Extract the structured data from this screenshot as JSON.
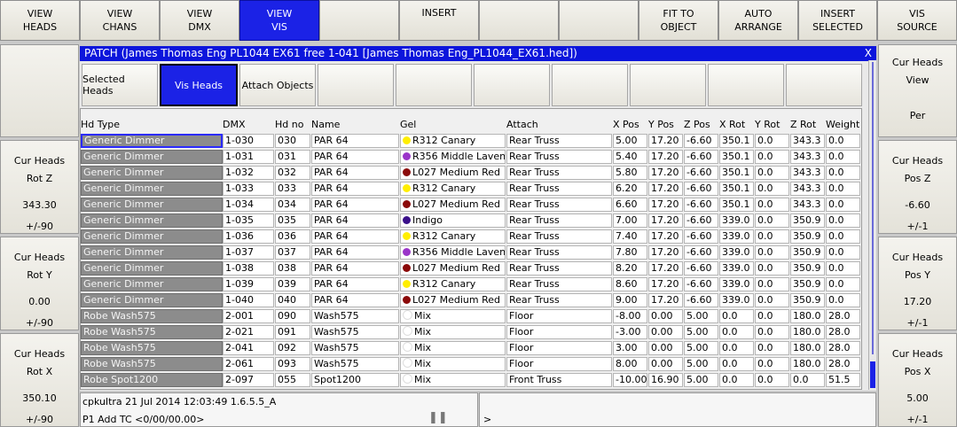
{
  "toolbar": {
    "view_heads": [
      "VIEW",
      "HEADS"
    ],
    "view_chans": [
      "VIEW",
      "CHANS"
    ],
    "view_dmx": [
      "VIEW",
      "DMX"
    ],
    "view_vis": [
      "VIEW",
      "VIS"
    ],
    "insert": "INSERT",
    "fit_to_object": [
      "FIT TO",
      "OBJECT"
    ],
    "auto_arrange": [
      "AUTO",
      "ARRANGE"
    ],
    "insert_selected": [
      "INSERT",
      "SELECTED"
    ],
    "vis_source": [
      "VIS",
      "SOURCE"
    ]
  },
  "left_panel": {
    "rot_z": {
      "title": "Cur Heads",
      "label": "Rot Z",
      "value": "343.30",
      "step": "+/-90"
    },
    "rot_y": {
      "title": "Cur Heads",
      "label": "Rot Y",
      "value": "0.00",
      "step": "+/-90"
    },
    "rot_x": {
      "title": "Cur Heads",
      "label": "Rot X",
      "value": "350.10",
      "step": "+/-90"
    }
  },
  "right_panel": {
    "view": {
      "title": "Cur Heads",
      "label": "View",
      "value": "Per"
    },
    "pos_z": {
      "title": "Cur Heads",
      "label": "Pos Z",
      "value": "-6.60",
      "step": "+/-1"
    },
    "pos_y": {
      "title": "Cur Heads",
      "label": "Pos Y",
      "value": "17.20",
      "step": "+/-1"
    },
    "pos_x": {
      "title": "Cur Heads",
      "label": "Pos X",
      "value": "5.00",
      "step": "+/-1"
    }
  },
  "window": {
    "title": "PATCH (James Thomas Eng PL1044 EX61 free 1-041 [James Thomas Eng_PL1044_EX61.hed])",
    "close": "X"
  },
  "tabs": [
    "Selected Heads",
    "Vis Heads",
    "Attach Objects"
  ],
  "columns": [
    "Hd Type",
    "DMX",
    "Hd no",
    "Name",
    "Gel",
    "Attach",
    "X Pos",
    "Y Pos",
    "Z Pos",
    "X Rot",
    "Y Rot",
    "Z Rot",
    "Weight"
  ],
  "colors": {
    "canary": "#ffee00",
    "lavender": "#9a35c9",
    "medium_red": "#8b0a0a",
    "indigo": "#3a108a",
    "mix": "#ffffff"
  },
  "rows": [
    {
      "type": "Generic Dimmer",
      "dmx": "1-030",
      "hd": "030",
      "name": "PAR 64",
      "gel": "R312 Canary",
      "gelc": "#ffee00",
      "attach": "Rear Truss",
      "x": "5.00",
      "y": "17.20",
      "z": "-6.60",
      "xr": "350.1",
      "yr": "0.0",
      "zr": "343.3",
      "w": "0.0"
    },
    {
      "type": "Generic Dimmer",
      "dmx": "1-031",
      "hd": "031",
      "name": "PAR 64",
      "gel": "R356 Middle Lavende",
      "gelc": "#9a35c9",
      "attach": "Rear Truss",
      "x": "5.40",
      "y": "17.20",
      "z": "-6.60",
      "xr": "350.1",
      "yr": "0.0",
      "zr": "343.3",
      "w": "0.0"
    },
    {
      "type": "Generic Dimmer",
      "dmx": "1-032",
      "hd": "032",
      "name": "PAR 64",
      "gel": "L027 Medium Red",
      "gelc": "#8b0a0a",
      "attach": "Rear Truss",
      "x": "5.80",
      "y": "17.20",
      "z": "-6.60",
      "xr": "350.1",
      "yr": "0.0",
      "zr": "343.3",
      "w": "0.0"
    },
    {
      "type": "Generic Dimmer",
      "dmx": "1-033",
      "hd": "033",
      "name": "PAR 64",
      "gel": "R312 Canary",
      "gelc": "#ffee00",
      "attach": "Rear Truss",
      "x": "6.20",
      "y": "17.20",
      "z": "-6.60",
      "xr": "350.1",
      "yr": "0.0",
      "zr": "343.3",
      "w": "0.0"
    },
    {
      "type": "Generic Dimmer",
      "dmx": "1-034",
      "hd": "034",
      "name": "PAR 64",
      "gel": "L027 Medium Red",
      "gelc": "#8b0a0a",
      "attach": "Rear Truss",
      "x": "6.60",
      "y": "17.20",
      "z": "-6.60",
      "xr": "350.1",
      "yr": "0.0",
      "zr": "343.3",
      "w": "0.0"
    },
    {
      "type": "Generic Dimmer",
      "dmx": "1-035",
      "hd": "035",
      "name": "PAR 64",
      "gel": "Indigo",
      "gelc": "#3a108a",
      "attach": "Rear Truss",
      "x": "7.00",
      "y": "17.20",
      "z": "-6.60",
      "xr": "339.0",
      "yr": "0.0",
      "zr": "350.9",
      "w": "0.0"
    },
    {
      "type": "Generic Dimmer",
      "dmx": "1-036",
      "hd": "036",
      "name": "PAR 64",
      "gel": "R312 Canary",
      "gelc": "#ffee00",
      "attach": "Rear Truss",
      "x": "7.40",
      "y": "17.20",
      "z": "-6.60",
      "xr": "339.0",
      "yr": "0.0",
      "zr": "350.9",
      "w": "0.0"
    },
    {
      "type": "Generic Dimmer",
      "dmx": "1-037",
      "hd": "037",
      "name": "PAR 64",
      "gel": "R356 Middle Lavende",
      "gelc": "#9a35c9",
      "attach": "Rear Truss",
      "x": "7.80",
      "y": "17.20",
      "z": "-6.60",
      "xr": "339.0",
      "yr": "0.0",
      "zr": "350.9",
      "w": "0.0"
    },
    {
      "type": "Generic Dimmer",
      "dmx": "1-038",
      "hd": "038",
      "name": "PAR 64",
      "gel": "L027 Medium Red",
      "gelc": "#8b0a0a",
      "attach": "Rear Truss",
      "x": "8.20",
      "y": "17.20",
      "z": "-6.60",
      "xr": "339.0",
      "yr": "0.0",
      "zr": "350.9",
      "w": "0.0"
    },
    {
      "type": "Generic Dimmer",
      "dmx": "1-039",
      "hd": "039",
      "name": "PAR 64",
      "gel": "R312 Canary",
      "gelc": "#ffee00",
      "attach": "Rear Truss",
      "x": "8.60",
      "y": "17.20",
      "z": "-6.60",
      "xr": "339.0",
      "yr": "0.0",
      "zr": "350.9",
      "w": "0.0"
    },
    {
      "type": "Generic Dimmer",
      "dmx": "1-040",
      "hd": "040",
      "name": "PAR 64",
      "gel": "L027 Medium Red",
      "gelc": "#8b0a0a",
      "attach": "Rear Truss",
      "x": "9.00",
      "y": "17.20",
      "z": "-6.60",
      "xr": "339.0",
      "yr": "0.0",
      "zr": "350.9",
      "w": "0.0"
    },
    {
      "type": "Robe Wash575",
      "dmx": "2-001",
      "hd": "090",
      "name": "Wash575",
      "gel": "Mix",
      "gelc": "#ffffff",
      "attach": "Floor",
      "x": "-8.00",
      "y": "0.00",
      "z": "5.00",
      "xr": "0.0",
      "yr": "0.0",
      "zr": "180.0",
      "w": "28.0"
    },
    {
      "type": "Robe Wash575",
      "dmx": "2-021",
      "hd": "091",
      "name": "Wash575",
      "gel": "Mix",
      "gelc": "#ffffff",
      "attach": "Floor",
      "x": "-3.00",
      "y": "0.00",
      "z": "5.00",
      "xr": "0.0",
      "yr": "0.0",
      "zr": "180.0",
      "w": "28.0"
    },
    {
      "type": "Robe Wash575",
      "dmx": "2-041",
      "hd": "092",
      "name": "Wash575",
      "gel": "Mix",
      "gelc": "#ffffff",
      "attach": "Floor",
      "x": "3.00",
      "y": "0.00",
      "z": "5.00",
      "xr": "0.0",
      "yr": "0.0",
      "zr": "180.0",
      "w": "28.0"
    },
    {
      "type": "Robe Wash575",
      "dmx": "2-061",
      "hd": "093",
      "name": "Wash575",
      "gel": "Mix",
      "gelc": "#ffffff",
      "attach": "Floor",
      "x": "8.00",
      "y": "0.00",
      "z": "5.00",
      "xr": "0.0",
      "yr": "0.0",
      "zr": "180.0",
      "w": "28.0"
    },
    {
      "type": "Robe Spot1200",
      "dmx": "2-097",
      "hd": "055",
      "name": "Spot1200",
      "gel": "Mix",
      "gelc": "#ffffff",
      "attach": "Front Truss",
      "x": "-10.00",
      "y": "16.90",
      "z": "5.00",
      "xr": "0.0",
      "yr": "0.0",
      "zr": "0.0",
      "w": "51.5"
    }
  ],
  "status": {
    "line1": "cpkultra 21 Jul 2014 12:03:49 1.6.5.5_A",
    "line2": "P1  Add  TC <0/00/00.00>",
    "pause": "❚❚",
    "prompt": ">"
  }
}
